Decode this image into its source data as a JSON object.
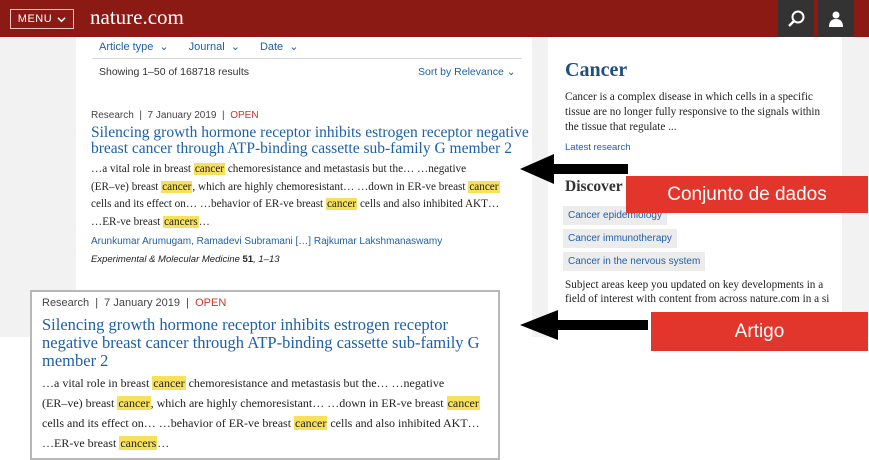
{
  "header": {
    "menu_label": "MENU",
    "brand": "nature.com",
    "colors": {
      "bar": "#8b1a14",
      "icon_bg": "#333333"
    },
    "icons": [
      "chevron-down-icon",
      "search-icon",
      "user-icon"
    ]
  },
  "filters": {
    "items": [
      "Article type",
      "Journal",
      "Date"
    ],
    "showing": "Showing 1–50 of 168718 results",
    "sort": "Sort by Relevance"
  },
  "article": {
    "type": "Research",
    "date": "7 January 2019",
    "access": "OPEN",
    "title": "Silencing growth hormone receptor inhibits estrogen receptor negative breast cancer through ATP-binding cassette sub-family G member 2",
    "snippet_lines": [
      [
        "…a vital role in breast ",
        "cancer",
        " chemoresistance and metastasis but the… …negative"
      ],
      [
        "(ER–ve) breast ",
        "cancer",
        ", which are highly chemoresistant… …down in ER-ve breast ",
        "cancer"
      ],
      [
        "cells and its effect on… …behavior of ER-ve breast ",
        "cancer",
        " cells and also inhibited AKT…"
      ],
      [
        "…ER-ve breast ",
        "cancers",
        "…"
      ]
    ],
    "authors": "Arunkumar Arumugam, Ramadevi Subramani  […]  Rajkumar Lakshmanaswamy",
    "journal": "Experimental & Molecular Medicine",
    "volume": "51",
    "pages": ", 1–13"
  },
  "sidebar": {
    "title": "Cancer",
    "description": "Cancer is a complex disease in which cells in a specific tissue are no longer fully responsive to the signals within the tissue that regulate ...",
    "latest_link": "Latest research",
    "discover": "Discover more subjects",
    "subjects": [
      "Cancer epidemiology",
      "Cancer immunotherapy",
      "Cancer in the nervous system"
    ],
    "footer": "Subject areas keep you updated on key developments in a field of interest with content from across nature.com in a si"
  },
  "annotations": {
    "dataset_label": "Conjunto de dados",
    "article_label": "Artigo",
    "label_color": "#e2352b"
  }
}
